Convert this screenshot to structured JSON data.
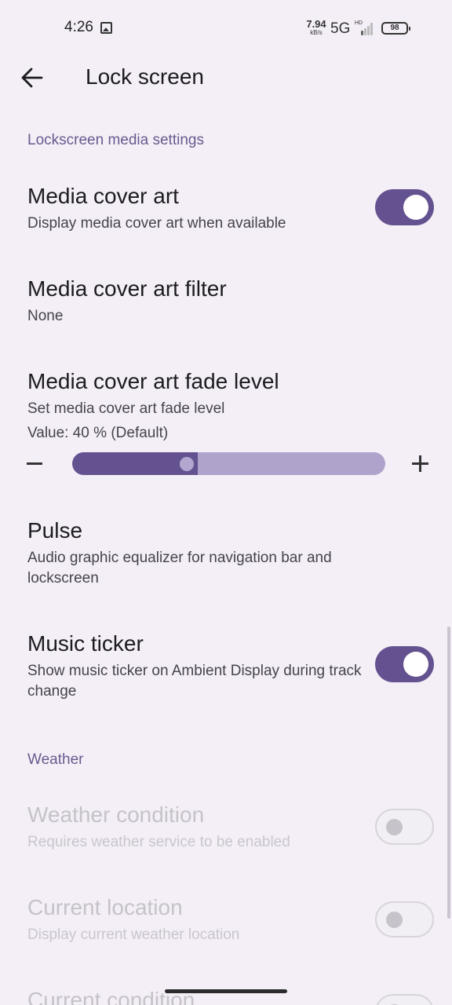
{
  "status_bar": {
    "time": "4:26",
    "speed_value": "7.94",
    "speed_unit": "kB/s",
    "network": "5G",
    "signal_label": "HD",
    "battery": "98"
  },
  "header": {
    "title": "Lock screen"
  },
  "sections": {
    "media": "Lockscreen media settings",
    "weather": "Weather"
  },
  "media_cover_art": {
    "title": "Media cover art",
    "summary": "Display media cover art when available",
    "enabled": true
  },
  "media_cover_art_filter": {
    "title": "Media cover art filter",
    "summary": "None"
  },
  "media_cover_art_fade": {
    "title": "Media cover art fade level",
    "summary": "Set media cover art fade level",
    "value_text": "Value: 40 % (Default)",
    "value_percent": 40
  },
  "pulse": {
    "title": "Pulse",
    "summary": "Audio graphic equalizer for navigation bar and lockscreen"
  },
  "music_ticker": {
    "title": "Music ticker",
    "summary": "Show music ticker on Ambient Display during track change",
    "enabled": true
  },
  "weather_condition": {
    "title": "Weather condition",
    "summary": "Requires weather service to be enabled",
    "enabled": false
  },
  "current_location": {
    "title": "Current location",
    "summary": "Display current weather location",
    "enabled": false
  },
  "current_condition": {
    "title": "Current condition",
    "enabled": false
  },
  "colors": {
    "accent": "#645290",
    "section": "#6a5a8e",
    "background": "#f4eff7"
  }
}
